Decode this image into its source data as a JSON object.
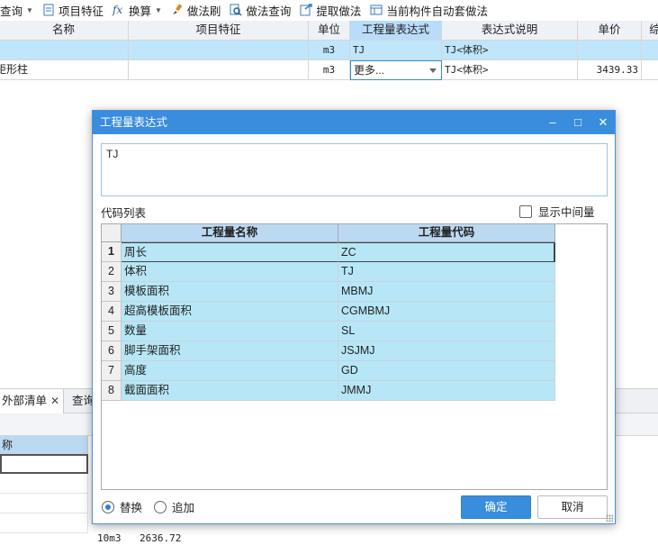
{
  "toolbar": {
    "query": "查询",
    "item_feature": "项目特征",
    "convert": "换算",
    "method_brush": "做法刷",
    "method_query": "做法查询",
    "extract_method": "提取做法",
    "auto_apply": "当前构件自动套做法"
  },
  "grid": {
    "headers": [
      "名称",
      "项目特征",
      "单位",
      "工程量表达式",
      "表达式说明",
      "单价",
      "综"
    ],
    "rows": [
      {
        "name": "",
        "feature": "",
        "unit": "m3",
        "expr": "TJ",
        "desc": "TJ<体积>",
        "price": ""
      },
      {
        "name": "矩形柱",
        "feature": "",
        "unit": "m3",
        "expr": "更多...",
        "desc": "TJ<体积>",
        "price": "3439.33"
      }
    ]
  },
  "bottom": {
    "tab_external": "外部清单",
    "tab_query": "查询",
    "col_name": "称",
    "unit": "10m3",
    "price": "2636.72"
  },
  "dialog": {
    "title": "工程量表达式",
    "expression": "TJ",
    "code_list_label": "代码列表",
    "show_intermediate": "显示中间量",
    "table_headers": [
      "工程量名称",
      "工程量代码"
    ],
    "table_rows": [
      {
        "n": "1",
        "name": "周长",
        "code": "ZC"
      },
      {
        "n": "2",
        "name": "体积",
        "code": "TJ"
      },
      {
        "n": "3",
        "name": "模板面积",
        "code": "MBMJ"
      },
      {
        "n": "4",
        "name": "超高模板面积",
        "code": "CGMBMJ"
      },
      {
        "n": "5",
        "name": "数量",
        "code": "SL"
      },
      {
        "n": "6",
        "name": "脚手架面积",
        "code": "JSJMJ"
      },
      {
        "n": "7",
        "name": "高度",
        "code": "GD"
      },
      {
        "n": "8",
        "name": "截面面积",
        "code": "JMMJ"
      }
    ],
    "replace": "替换",
    "append": "追加",
    "ok": "确定",
    "cancel": "取消"
  }
}
